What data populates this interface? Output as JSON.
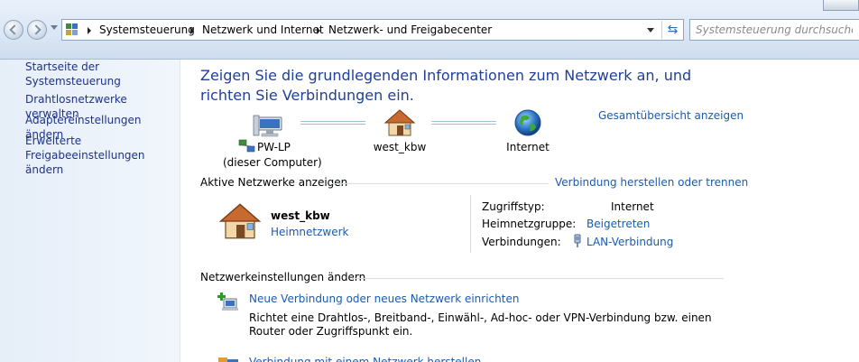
{
  "address_bar": {
    "breadcrumbs": [
      "Systemsteuerung",
      "Netzwerk und Internet",
      "Netzwerk- und Freigabecenter"
    ],
    "search_placeholder": "Systemsteuerung durchsuchen",
    "refresh_glyph": "⇆"
  },
  "sidebar": {
    "items": [
      {
        "label": "Startseite der Systemsteuerung"
      },
      {
        "label": "Drahtlosnetzwerke verwalten"
      },
      {
        "label": "Adaptereinstellungen ändern"
      },
      {
        "label": "Erweiterte\nFreigabeeinstellungen ändern"
      }
    ]
  },
  "main": {
    "heading": "Zeigen Sie die grundlegenden Informationen zum Netzwerk an, und richten Sie Verbindungen ein.",
    "map": {
      "computer_name": "PW-LP",
      "computer_sub": "(dieser Computer)",
      "network_name": "west_kbw",
      "internet_label": "Internet",
      "overview_link": "Gesamtübersicht anzeigen"
    },
    "active_networks": {
      "title": "Aktive Netzwerke anzeigen",
      "connect_link": "Verbindung herstellen oder trennen",
      "network": {
        "name": "west_kbw",
        "type": "Heimnetzwerk"
      },
      "properties": [
        {
          "label": "Zugriffstyp:",
          "value": "Internet"
        },
        {
          "label": "Heimnetzgruppe:",
          "value": "Beigetreten"
        },
        {
          "label": "Verbindungen:",
          "value": "LAN-Verbindung"
        }
      ]
    },
    "settings": {
      "title": "Netzwerkeinstellungen ändern",
      "tasks": [
        {
          "link": "Neue Verbindung oder neues Netzwerk einrichten",
          "desc": "Richtet eine Drahtlos-, Breitband-, Einwähl-, Ad-hoc- oder VPN-Verbindung bzw. einen Router oder Zugriffspunkt ein."
        },
        {
          "link": "Verbindung mit einem Netzwerk herstellen"
        }
      ]
    }
  },
  "colors": {
    "link": "#1a5bb0",
    "heading": "#1f3f9a",
    "sidebar_link": "#1e3287"
  }
}
